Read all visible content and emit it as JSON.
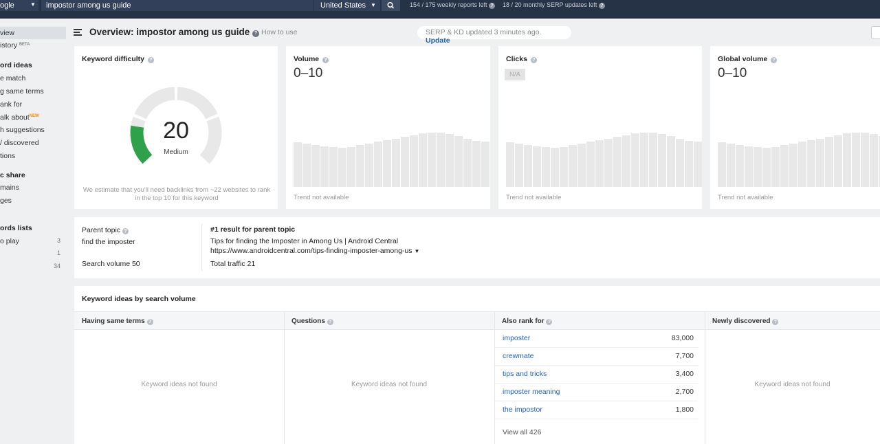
{
  "topbar": {
    "engine_label": "ogle",
    "search_value": "impostor among us guide",
    "country": "United States",
    "weekly_reports": "154 / 175 weekly reports left",
    "serp_updates": "18 / 20 monthly SERP updates left"
  },
  "sidebar": {
    "items": [
      {
        "label": "view"
      },
      {
        "label": "istory",
        "badge": "BETA"
      },
      {
        "heading": "ord ideas"
      },
      {
        "label": "e match"
      },
      {
        "label": "g same terms"
      },
      {
        "label": "ank for"
      },
      {
        "label": "alk about",
        "badge": "NEW"
      },
      {
        "label": "h suggestions"
      },
      {
        "label": "/ discovered"
      },
      {
        "label": "tions"
      },
      {
        "heading": "c share"
      },
      {
        "label": "mains"
      },
      {
        "label": "ges"
      },
      {
        "heading": "ords lists"
      },
      {
        "label": "o play",
        "count": "3"
      },
      {
        "label": "",
        "count": "1"
      },
      {
        "label": "",
        "count": "34"
      }
    ]
  },
  "header": {
    "title": "Overview: impostor among us guide",
    "how_to_use": "How to use",
    "serp_status": "SERP & KD updated 3 minutes ago.",
    "update_label": "Update"
  },
  "kd_card": {
    "title": "Keyword difficulty",
    "value": "20",
    "level": "Medium",
    "difficulty_fraction": 0.2,
    "note": "We estimate that you'll need backlinks from ~22 websites to rank in the top 10 for this keyword",
    "colors": {
      "filled": "#2ea14a",
      "empty": "#e8e8e8"
    }
  },
  "volume_card": {
    "title": "Volume",
    "value": "0–10",
    "trend_note": "Trend not available"
  },
  "clicks_card": {
    "title": "Clicks",
    "value": "N/A",
    "trend_note": "Trend not available"
  },
  "global_card": {
    "title": "Global volume",
    "value": "0–10",
    "trend_note": "Trend not available"
  },
  "trend_placeholder": [
    0.81,
    0.79,
    0.76,
    0.74,
    0.72,
    0.71,
    0.73,
    0.76,
    0.79,
    0.82,
    0.85,
    0.88,
    0.91,
    0.94,
    0.97,
    0.99,
    0.99,
    0.96,
    0.93,
    0.88,
    0.84,
    0.82
  ],
  "parent_topic": {
    "label": "Parent topic",
    "topic": "find the imposter",
    "search_volume": "Search volume 50",
    "result_label": "#1 result for parent topic",
    "result_title": "Tips for finding the Imposter in Among Us | Android Central",
    "result_url": "https://www.androidcentral.com/tips-finding-imposter-among-us",
    "total_traffic": "Total traffic 21"
  },
  "keyword_ideas": {
    "title": "Keyword ideas by search volume",
    "columns": [
      {
        "title": "Having same terms",
        "empty": "Keyword ideas not found"
      },
      {
        "title": "Questions",
        "empty": "Keyword ideas not found"
      },
      {
        "title": "Also rank for"
      },
      {
        "title": "Newly discovered",
        "empty": "Keyword ideas not found"
      }
    ],
    "also_rank_for": [
      {
        "keyword": "imposter",
        "volume": "83,000"
      },
      {
        "keyword": "crewmate",
        "volume": "7,700"
      },
      {
        "keyword": "tips and tricks",
        "volume": "3,400"
      },
      {
        "keyword": "imposter meaning",
        "volume": "2,700"
      },
      {
        "keyword": "the impostor",
        "volume": "1,800"
      }
    ],
    "view_all": "View all 426"
  }
}
